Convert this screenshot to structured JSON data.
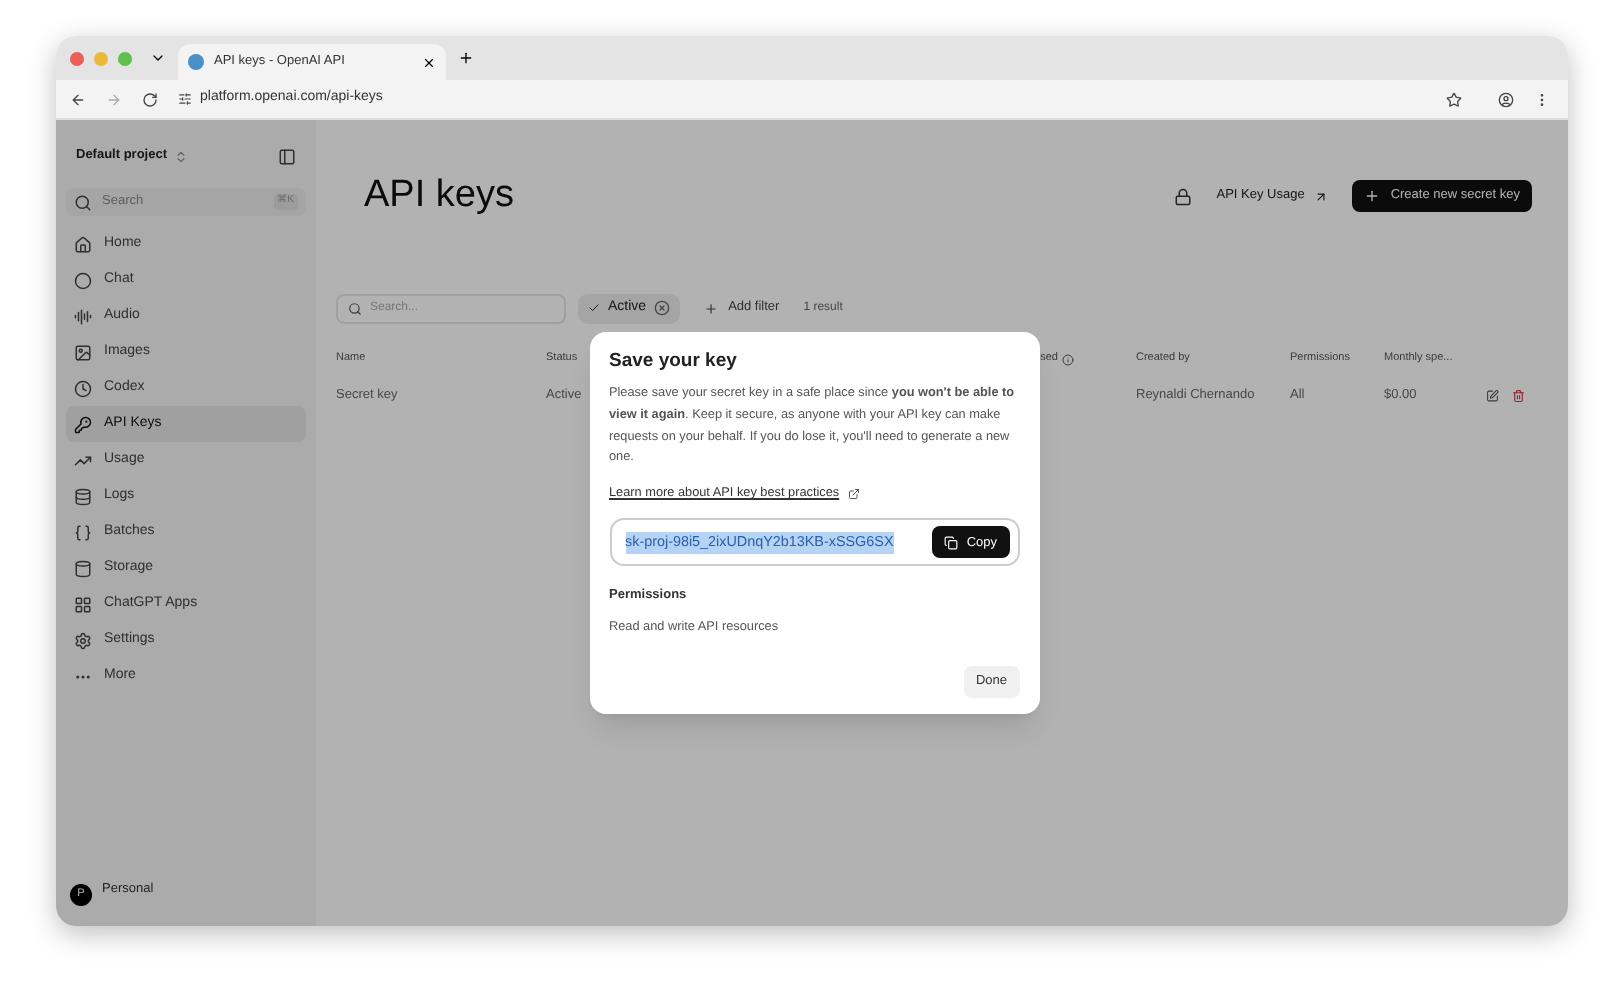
{
  "browser": {
    "tab_title": "API keys - OpenAI API",
    "url": "platform.openai.com/api-keys"
  },
  "sidebar": {
    "project": "Default project",
    "search": {
      "placeholder": "Search",
      "shortcut": "⌘K"
    },
    "items": [
      {
        "label": "Home",
        "selected": false
      },
      {
        "label": "Chat",
        "selected": false
      },
      {
        "label": "Audio",
        "selected": false
      },
      {
        "label": "Images",
        "selected": false
      },
      {
        "label": "Codex",
        "selected": false
      },
      {
        "label": "API Keys",
        "selected": true
      },
      {
        "label": "Usage",
        "selected": false
      },
      {
        "label": "Logs",
        "selected": false
      },
      {
        "label": "Batches",
        "selected": false
      },
      {
        "label": "Storage",
        "selected": false
      },
      {
        "label": "ChatGPT Apps",
        "selected": false
      },
      {
        "label": "Settings",
        "selected": false
      },
      {
        "label": "More",
        "selected": false
      }
    ],
    "account": {
      "avatar": "P",
      "name": "Personal"
    }
  },
  "page": {
    "title": "API keys",
    "usage_link": "API Key Usage",
    "create_button": "Create new secret key"
  },
  "filters": {
    "search": {
      "placeholder": "Search..."
    },
    "active_filter": "Active",
    "add_filter": "Add filter",
    "result_count": "1 result"
  },
  "table": {
    "columns": [
      "Name",
      "Status",
      "sed",
      "Created by",
      "Permissions",
      "Monthly spe..."
    ],
    "rows": [
      {
        "name": "Secret key",
        "status": "Active",
        "created_by": "Reynaldi Chernando",
        "permissions": "All",
        "monthly_spend": "$0.00"
      }
    ]
  },
  "dialog": {
    "title": "Save your key",
    "message": "Please save your secret key in a safe place since **you won't be able to view it again**. Keep it secure, as anyone with your API key can make requests on your behalf. If you do lose it, you'll need to generate a new one.",
    "link": "Learn more about API key best practices",
    "key": {
      "value": "sk-proj-98i5_2ixUDnqY2b13KB-xSSG6SX",
      "selected": true
    },
    "copy_button": "Copy",
    "permissions_label": "Permissions",
    "permissions_value": "Read and write API resources",
    "done_button": "Done"
  }
}
